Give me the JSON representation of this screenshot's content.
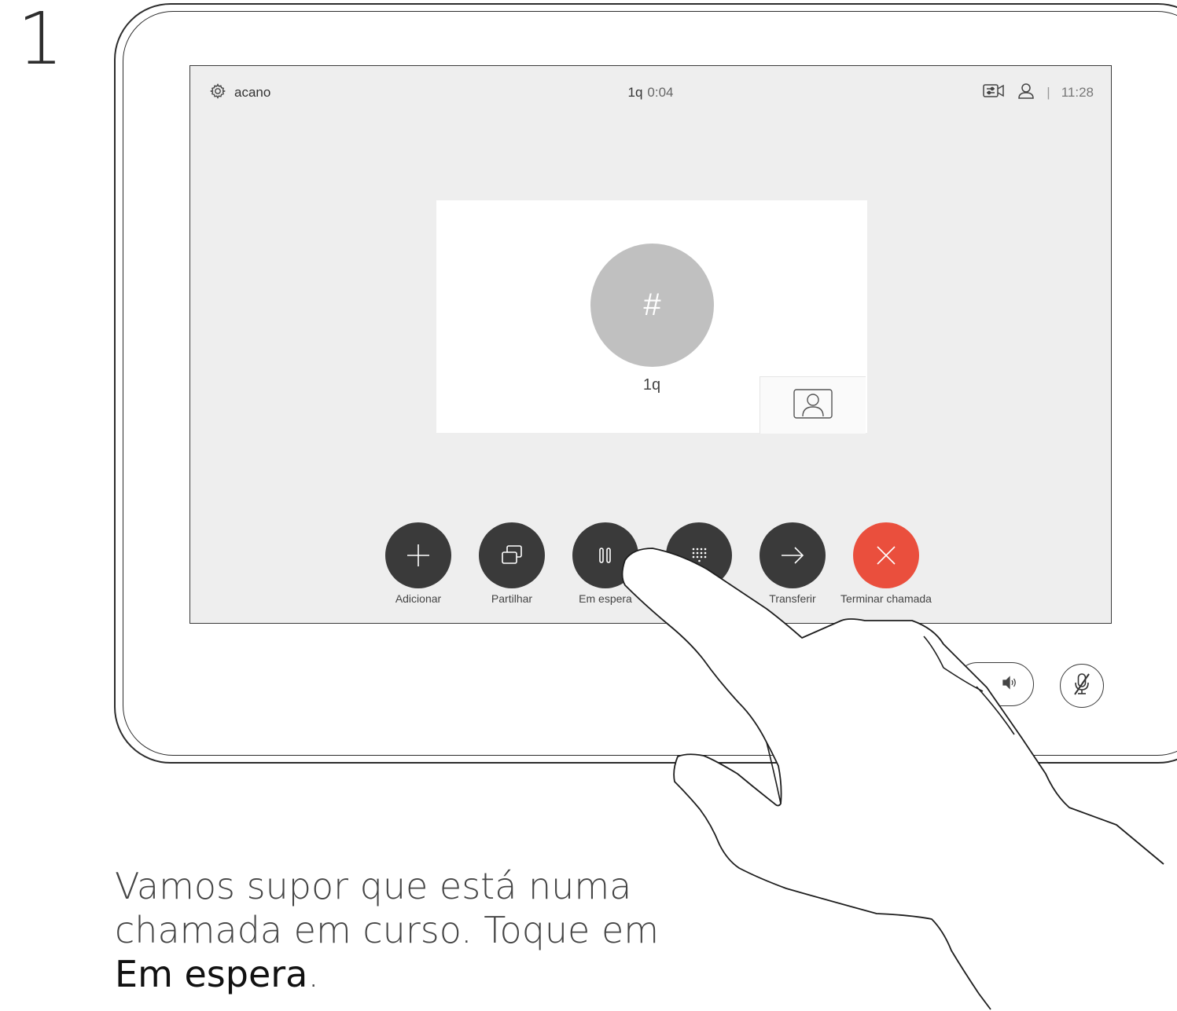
{
  "step": {
    "number": "1"
  },
  "screen": {
    "status": {
      "system_name": "acano",
      "call_name": "1q",
      "call_duration": "0:04",
      "separator": "|",
      "time": "11:28"
    },
    "call": {
      "avatar_glyph": "#",
      "name": "1q"
    },
    "controls": [
      {
        "label": "Adicionar",
        "icon": "plus-icon"
      },
      {
        "label": "Partilhar",
        "icon": "share-icon"
      },
      {
        "label": "Em espera",
        "icon": "pause-icon"
      },
      {
        "label": "",
        "icon": "keypad-icon"
      },
      {
        "label": "Transferir",
        "icon": "arrow-right-icon"
      },
      {
        "label": "Terminar chamada",
        "icon": "close-icon",
        "color": "#ea4f3d"
      }
    ]
  },
  "device": {
    "speaker_icon": "speaker-icon",
    "mute_icon": "microphone-muted-icon"
  },
  "instruction": {
    "text_line1": "Vamos supor que está numa",
    "text_line2": "chamada em curso. Toque em",
    "highlight": "Em espera",
    "suffix": "."
  }
}
